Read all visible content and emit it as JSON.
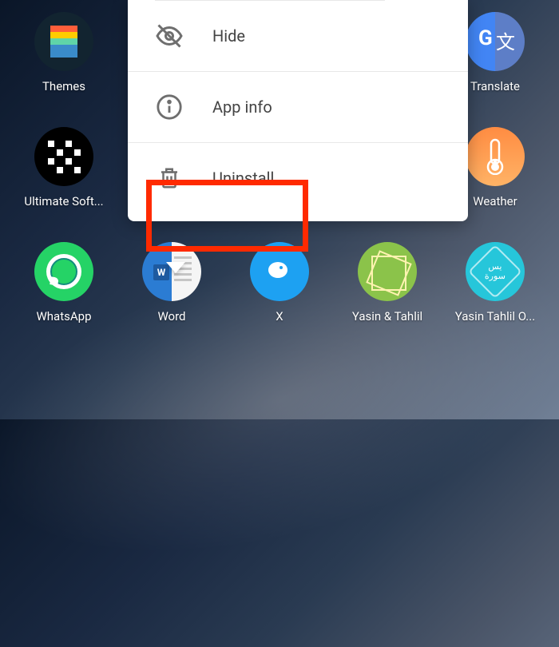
{
  "apps": {
    "row1": [
      {
        "label": "Themes"
      },
      {
        "label": ""
      },
      {
        "label": ""
      },
      {
        "label": ""
      },
      {
        "label": "Translate"
      }
    ],
    "row2": [
      {
        "label": "Ultimate Soft..."
      },
      {
        "label": ""
      },
      {
        "label": ""
      },
      {
        "label": ""
      },
      {
        "label": "Weather"
      }
    ],
    "row3": [
      {
        "label": "WhatsApp"
      },
      {
        "label": "Word"
      },
      {
        "label": "X"
      },
      {
        "label": "Yasin & Tahlil"
      },
      {
        "label": "Yasin Tahlil O..."
      }
    ]
  },
  "menu": {
    "hide": "Hide",
    "app_info": "App info",
    "uninstall": "Uninstall"
  }
}
